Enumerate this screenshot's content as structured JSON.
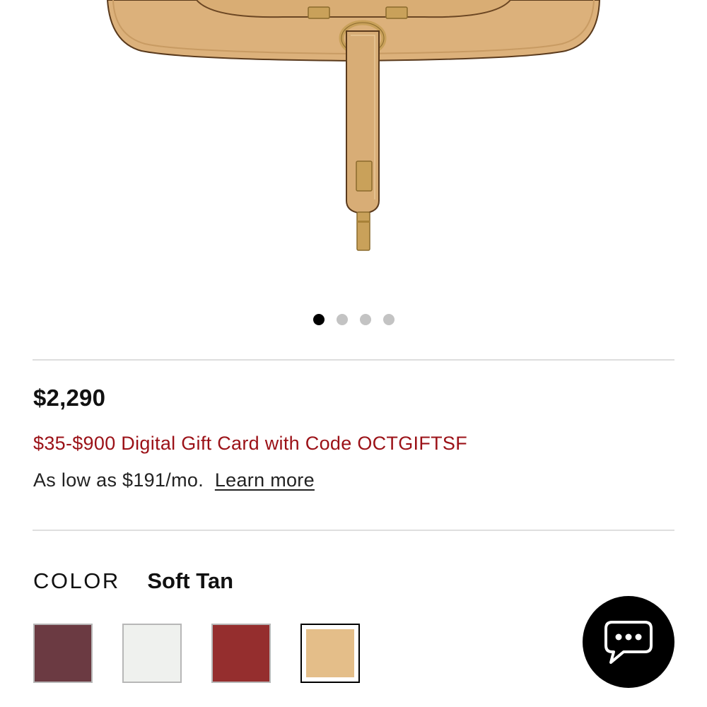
{
  "product": {
    "image_alt": "leather-handbag",
    "colors_accent": {
      "leather": "#d7ae77",
      "hardware": "#c9a15a"
    },
    "carousel": {
      "count": 4,
      "active_index": 0
    }
  },
  "pricing": {
    "price": "$2,290",
    "promo": "$35-$900 Digital Gift Card with Code OCTGIFTSF",
    "financing_text": "As low as $191/mo.",
    "learn_more": "Learn more",
    "promo_color": "#9b1117"
  },
  "color_selector": {
    "label": "COLOR",
    "selected_name": "Soft Tan",
    "swatches": [
      {
        "color": "#6b3a42",
        "selected": false
      },
      {
        "color": "#eff1ee",
        "selected": false
      },
      {
        "color": "#952e2e",
        "selected": false
      },
      {
        "color": "#e4be89",
        "selected": true
      }
    ]
  },
  "chat": {
    "icon": "chat-bubble-icon"
  }
}
